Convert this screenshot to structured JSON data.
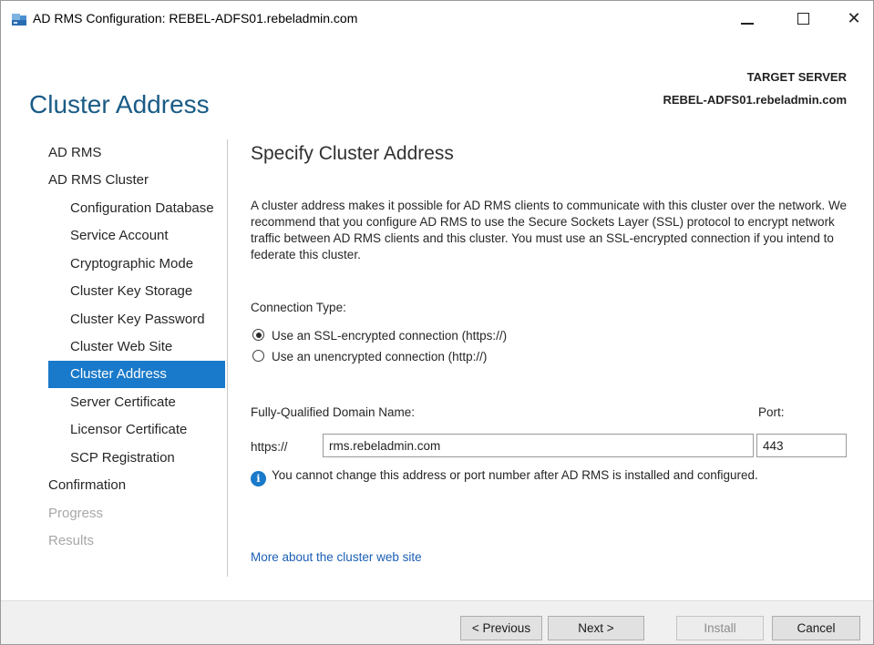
{
  "window": {
    "title": "AD RMS Configuration: REBEL-ADFS01.rebeladmin.com",
    "controls": {
      "minimize": "—",
      "maximize": "☐",
      "close": "✕"
    }
  },
  "header": {
    "page_title": "Cluster Address",
    "target_server_label": "TARGET SERVER",
    "target_server_value": "REBEL-ADFS01.rebeladmin.com"
  },
  "sidebar": {
    "items": [
      {
        "label": "AD RMS",
        "level": 0,
        "state": "normal"
      },
      {
        "label": "AD RMS Cluster",
        "level": 0,
        "state": "normal"
      },
      {
        "label": "Configuration Database",
        "level": 1,
        "state": "normal"
      },
      {
        "label": "Service Account",
        "level": 1,
        "state": "normal"
      },
      {
        "label": "Cryptographic Mode",
        "level": 1,
        "state": "normal"
      },
      {
        "label": "Cluster Key Storage",
        "level": 1,
        "state": "normal"
      },
      {
        "label": "Cluster Key Password",
        "level": 1,
        "state": "normal"
      },
      {
        "label": "Cluster Web Site",
        "level": 1,
        "state": "normal"
      },
      {
        "label": "Cluster Address",
        "level": 1,
        "state": "active"
      },
      {
        "label": "Server Certificate",
        "level": 1,
        "state": "normal"
      },
      {
        "label": "Licensor Certificate",
        "level": 1,
        "state": "normal"
      },
      {
        "label": "SCP Registration",
        "level": 1,
        "state": "normal"
      },
      {
        "label": "Confirmation",
        "level": 0,
        "state": "normal"
      },
      {
        "label": "Progress",
        "level": 0,
        "state": "disabled"
      },
      {
        "label": "Results",
        "level": 0,
        "state": "disabled"
      }
    ]
  },
  "main": {
    "section_title": "Specify Cluster Address",
    "description": "A cluster address makes it possible for AD RMS clients to communicate with this cluster over the network. We recommend that you configure AD RMS to use the Secure Sockets Layer (SSL) protocol to encrypt network traffic between AD RMS clients and this cluster. You must use an SSL-encrypted connection if you intend to federate this cluster.",
    "connection_type_label": "Connection Type:",
    "options": [
      {
        "label": "Use an SSL-encrypted connection (https://)",
        "checked": true
      },
      {
        "label": "Use an unencrypted connection (http://)",
        "checked": false
      }
    ],
    "fqdn_label": "Fully-Qualified Domain Name:",
    "port_label": "Port:",
    "url_prefix": "https://",
    "fqdn_value": "rms.rebeladmin.com",
    "port_value": "443",
    "info_icon": "i",
    "info_text": "You cannot change this address or port number after AD RMS is installed and configured.",
    "more_link": "More about the cluster web site"
  },
  "footer": {
    "previous": "< Previous",
    "next": "Next >",
    "install": "Install",
    "cancel": "Cancel"
  },
  "colors": {
    "accent": "#1979ca",
    "title": "#1a5b86",
    "link": "#1a5fb4",
    "disabled_text": "#a8a8a8"
  }
}
